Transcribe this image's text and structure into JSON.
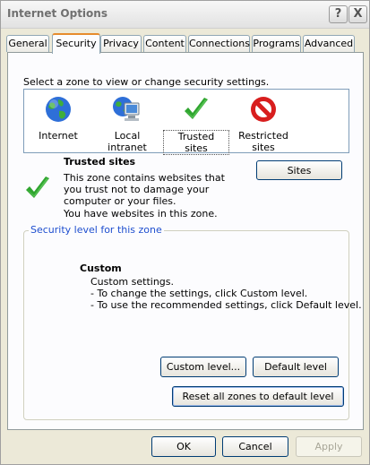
{
  "window": {
    "title": "Internet Options"
  },
  "title_buttons": {
    "help": "?",
    "close": "X"
  },
  "tabs": [
    {
      "label": "General"
    },
    {
      "label": "Security"
    },
    {
      "label": "Privacy"
    },
    {
      "label": "Content"
    },
    {
      "label": "Connections"
    },
    {
      "label": "Programs"
    },
    {
      "label": "Advanced"
    }
  ],
  "active_tab": "Security",
  "security": {
    "select_prompt": "Select a zone to view or change security settings.",
    "zones": [
      {
        "label": "Internet",
        "icon": "globe-icon"
      },
      {
        "label": "Local intranet",
        "icon": "intranet-computer-icon"
      },
      {
        "label": "Trusted sites",
        "icon": "checkmark-icon",
        "selected": true
      },
      {
        "label": "Restricted sites",
        "icon": "restricted-icon"
      }
    ],
    "zone_title": "Trusted sites",
    "zone_description": "This zone contains websites that you trust not to damage your computer or your files.",
    "zone_note": "You have websites in this zone.",
    "sites_button": "Sites",
    "level_group_label": "Security level for this zone",
    "level_title": "Custom",
    "level_lines": [
      "Custom settings.",
      "- To change the settings, click Custom level.",
      "- To use the recommended settings, click Default level."
    ],
    "custom_level_button": "Custom level...",
    "default_level_button": "Default level",
    "reset_all_button": "Reset all zones to default level"
  },
  "footer": {
    "ok": "OK",
    "cancel": "Cancel",
    "apply": "Apply"
  },
  "colors": {
    "tab_accent": "#e68b2c",
    "group_label": "#1f4fcf",
    "check_green": "#2fa52f",
    "restricted_red": "#d81e1e"
  }
}
